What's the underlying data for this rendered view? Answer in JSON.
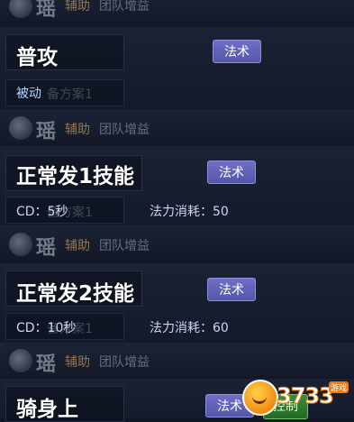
{
  "ghost_header": {
    "hero_name": "瑶",
    "role": "辅助",
    "team": "团队增益"
  },
  "ghost_plan_label": "备方案1",
  "skills": [
    {
      "name": "普攻",
      "type_label": "法术",
      "passive_label": "被动"
    },
    {
      "name_prefix": "正常发",
      "name_num": "1",
      "name_suffix": "技能",
      "type_label": "法术",
      "cd_label": "CD：5秒",
      "mana_label": "法力消耗：50"
    },
    {
      "name_prefix": "正常发",
      "name_num": "2",
      "name_suffix": "技能",
      "type_label": "法术",
      "cd_label": "CD：10秒",
      "mana_label": "法力消耗：60"
    },
    {
      "name": "骑身上",
      "type_label": "法术",
      "control_label": "控制"
    }
  ],
  "watermark": {
    "text": "3733",
    "sub": "游戏"
  }
}
